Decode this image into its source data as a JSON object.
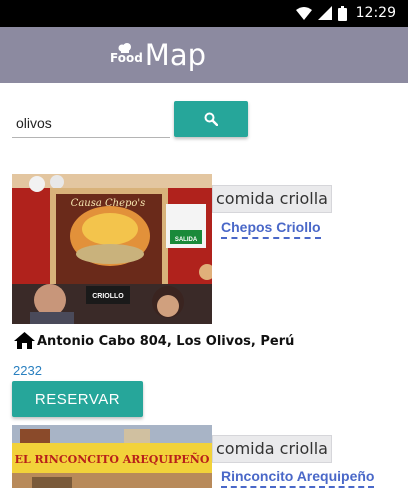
{
  "status_bar": {
    "time": "12:29",
    "icons": [
      "wifi-icon",
      "signal-icon",
      "battery-icon"
    ]
  },
  "app_bar": {
    "logo_small": "Food",
    "logo_big": "Map"
  },
  "search": {
    "query": "olivos",
    "button_icon": "search-icon"
  },
  "restaurants": [
    {
      "category": "comida criolla",
      "name": "Chepos Criollo",
      "photo_sign_top": "Causa Chepo's",
      "photo_sign_side": "SALIDA",
      "photo_sign_bottom": "CRIOLLO",
      "address_icon": "home-icon",
      "address": "Antonio Cabo 804, Los Olivos, Perú",
      "phone": "2232",
      "reserve_label": "RESERVAR"
    },
    {
      "category": "comida criolla",
      "name": "Rinconcito Arequipeño",
      "photo_sign": "EL RINCONCITO AREQUIPEÑO"
    }
  ],
  "colors": {
    "accent": "#26a69a",
    "app_bar": "#8c8aa0",
    "link": "#4a68c8"
  }
}
